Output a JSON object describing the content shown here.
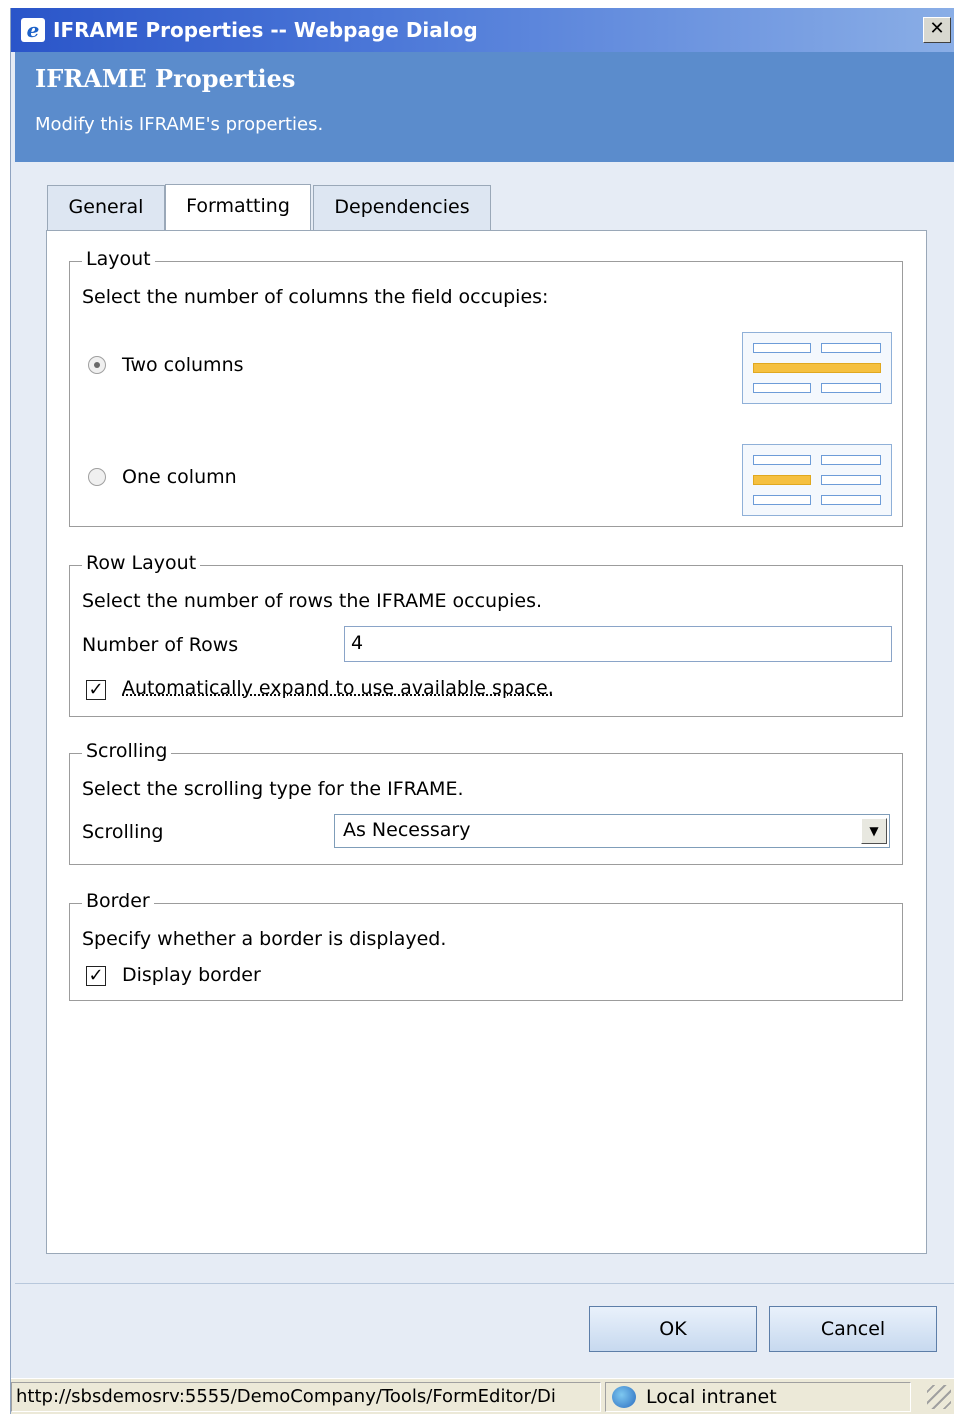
{
  "window": {
    "title": "IFRAME Properties -- Webpage Dialog",
    "close_label": "✕"
  },
  "header": {
    "title": "IFRAME Properties",
    "subtitle": "Modify this IFRAME's properties."
  },
  "tabs": [
    {
      "label": "General",
      "active": false
    },
    {
      "label": "Formatting",
      "active": true
    },
    {
      "label": "Dependencies",
      "active": false
    }
  ],
  "layout": {
    "legend": "Layout",
    "description": "Select the number of columns the field occupies:",
    "options": [
      {
        "label": "Two columns",
        "selected": true
      },
      {
        "label": "One column",
        "selected": false
      }
    ]
  },
  "row_layout": {
    "legend": "Row Layout",
    "description": "Select the number of rows the IFRAME occupies.",
    "rows_label": "Number of Rows",
    "rows_value": "4",
    "auto_expand_label": "Automatically expand to use available space.",
    "auto_expand_checked": true
  },
  "scrolling": {
    "legend": "Scrolling",
    "description": "Select the scrolling type for the IFRAME.",
    "field_label": "Scrolling",
    "selected_value": "As Necessary"
  },
  "border": {
    "legend": "Border",
    "description": "Specify whether a border is displayed.",
    "display_label": "Display border",
    "display_checked": true
  },
  "buttons": {
    "ok": "OK",
    "cancel": "Cancel"
  },
  "statusbar": {
    "url": "http://sbsdemosrv:5555/DemoCompany/Tools/FormEditor/Di",
    "zone": "Local intranet"
  },
  "colors": {
    "header_blue": "#5b8ccc",
    "highlight_bar": "#f5c040",
    "title_bar": "#2a55c9"
  }
}
